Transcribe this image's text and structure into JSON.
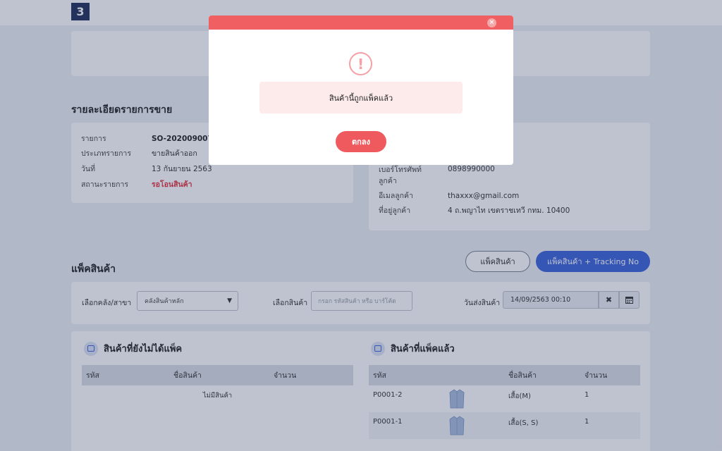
{
  "header": {
    "logo_text": "3"
  },
  "sale_details": {
    "title": "รายละเอียดรายการขาย",
    "rows": [
      {
        "label": "รายการ",
        "value": "SO-202009007"
      },
      {
        "label": "ประเภทรายการ",
        "value": "ขายสินค้าออก"
      },
      {
        "label": "วันที่",
        "value": "13 กันยายน 2563"
      },
      {
        "label": "สถานะรายการ",
        "value": "รอโอนสินค้า"
      }
    ]
  },
  "customer": {
    "rows": [
      {
        "label": "เบอร์โทรศัพท์ลูกค้า",
        "value": "0898990000"
      },
      {
        "label": "อีเมลลูกค้า",
        "value": "thaxxx@gmail.com"
      },
      {
        "label": "ที่อยู่ลูกค้า",
        "value": "4 ถ.พญาไท เขตราชเทวี กทม. 10400"
      }
    ]
  },
  "pack": {
    "title": "แพ็คสินค้า",
    "btn_pack": "แพ็คสินค้า",
    "btn_pack_tracking": "แพ็คสินค้า + Tracking No"
  },
  "filters": {
    "warehouse_label": "เลือกคลัง/สาขา",
    "warehouse_value": "คลังสินค้าหลัก",
    "product_label": "เลือกสินค้า",
    "product_placeholder": "กรอก รหัสสินค้า หรือ บาร์โค้ด",
    "ship_date_label": "วันส่งสินค้า",
    "ship_date_value": "14/09/2563 00:10"
  },
  "unpacked": {
    "title": "สินค้าที่ยังไม่ได้แพ็ค",
    "columns": [
      "รหัส",
      "ชื่อสินค้า",
      "จำนวน"
    ],
    "empty_text": "ไม่มีสินค้า"
  },
  "packed": {
    "title": "สินค้าที่แพ็คแล้ว",
    "columns": [
      "รหัส",
      "ชื่อสินค้า",
      "จำนวน"
    ],
    "rows": [
      {
        "code": "P0001-2",
        "name": "เสื้อ(M)",
        "qty": "1"
      },
      {
        "code": "P0001-1",
        "name": "เสื้อ(S, S)",
        "qty": "1"
      }
    ]
  },
  "modal": {
    "message": "สินค้านี้ถูกแพ็คแล้ว",
    "ok_label": "ตกลง"
  },
  "colors": {
    "modal_header": "#f05f61",
    "primary": "#3d63dc",
    "status_red": "#e5303e"
  }
}
